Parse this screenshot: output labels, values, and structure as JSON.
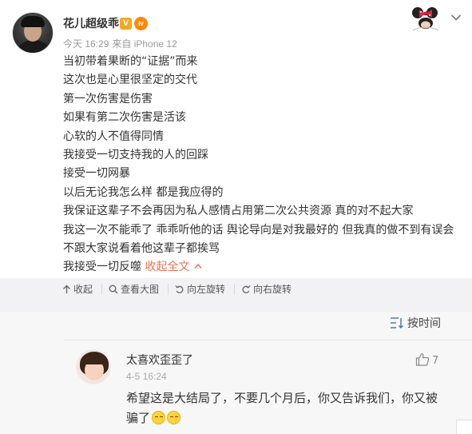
{
  "post": {
    "username": "花儿超级乖",
    "verified_badge": "V",
    "level_badge": "lv",
    "meta": {
      "time": "今天 16:29",
      "source": "来自 iPhone 12"
    },
    "lines": [
      "当初带着果断的“证据”而来",
      "这次也是心里很坚定的交代",
      "第一次伤害是伤害",
      "如果有第二次伤害是活该",
      "心软的人不值得同情",
      "我接受一切支持我的人的回踩",
      "接受一切网暴",
      "以后无论我怎么样 都是我应得的",
      "我保证这辈子不会再因为私人感情占用第二次公共资源 真的对不起大家",
      "我这一次不能乖了 乖乖听他的话 舆论导向是对我最好的 但我真的做不到有误会",
      "不跟大家说看着他这辈子都挨骂",
      "我接受一切反噬"
    ],
    "collapse_label": "收起全文"
  },
  "toolbar": {
    "collapse": "收起",
    "view_large": "查看大图",
    "rotate_left": "向左旋转",
    "rotate_right": "向右旋转"
  },
  "comments": {
    "sort_label": "按时间",
    "items": [
      {
        "name": "太喜欢歪歪了",
        "likes": "7",
        "time": "4-5 16:24",
        "text": "希望这是大结局了，不要几个月后，你又告诉我们，你又被骗了"
      }
    ]
  },
  "colors": {
    "accent": "#eb7350",
    "toolbar_bg": "#f2f2f5",
    "comment_bg": "#f7f7f7"
  },
  "icons": [
    "chevron-down-icon",
    "minnie-pendant-icon",
    "arrow-up-icon",
    "search-icon",
    "rotate-left-icon",
    "rotate-right-icon",
    "sort-icon",
    "thumbs-up-icon",
    "emoji-icon"
  ]
}
